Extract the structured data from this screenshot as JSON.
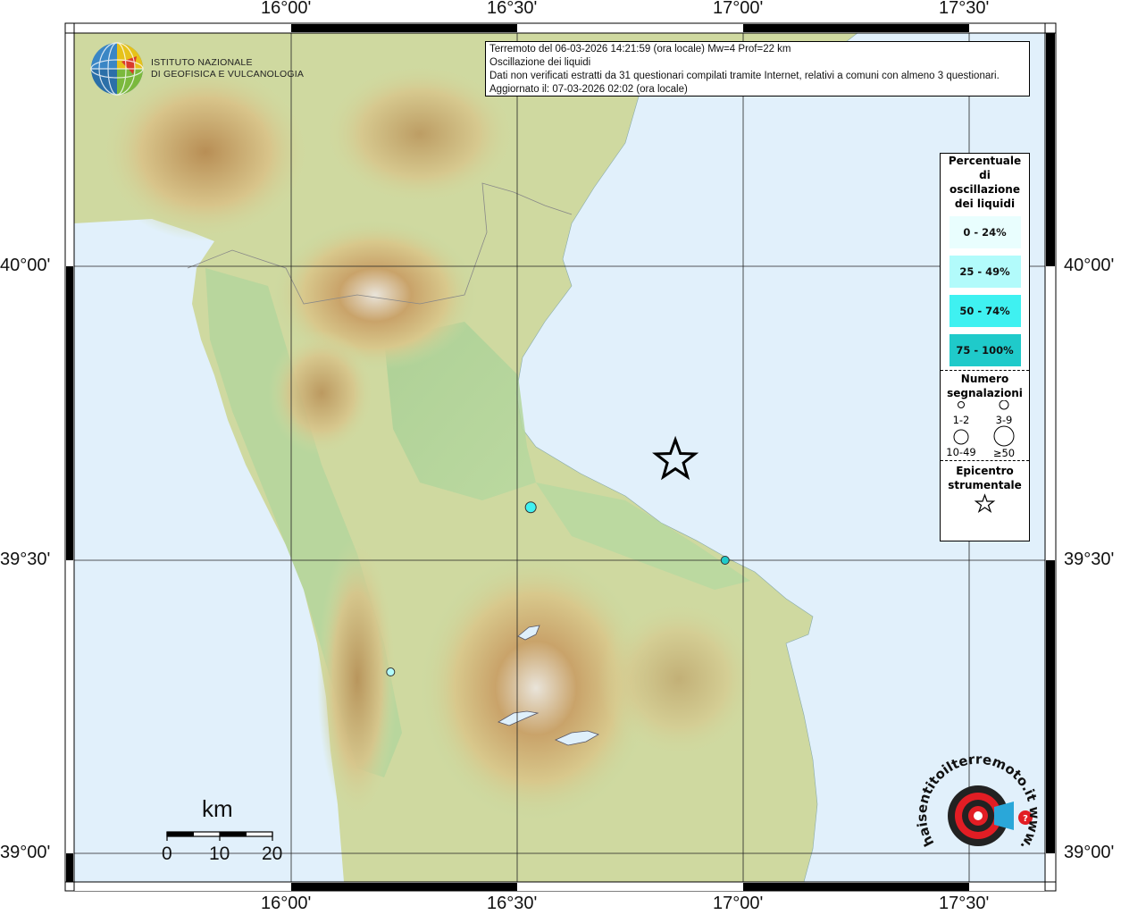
{
  "info": {
    "line1": "Terremoto del 06-03-2026 14:21:59 (ora locale) Mw=4 Prof=22 km",
    "line2": "Oscillazione dei liquidi",
    "line3": "Dati non verificati estratti da 31 questionari compilati tramite Internet, relativi a comuni con almeno 3 questionari.",
    "line4": "Aggiornato il: 07-03-2026 02:02 (ora locale)"
  },
  "logo": {
    "line1": "ISTITUTO NAZIONALE",
    "line2": "DI GEOFISICA E VULCANOLOGIA"
  },
  "axes": {
    "lon_labels": [
      "16°00'",
      "16°30'",
      "17°00'",
      "17°30'"
    ],
    "lat_labels": [
      "40°00'",
      "39°30'",
      "39°00'"
    ]
  },
  "legend": {
    "title": "Percentuale di oscillazione dei liquidi",
    "classes": [
      {
        "label": "0 - 24%",
        "color": "#e9fefe"
      },
      {
        "label": "25 - 49%",
        "color": "#b2fbfb"
      },
      {
        "label": "50 - 74%",
        "color": "#3ff1f1"
      },
      {
        "label": "75 - 100%",
        "color": "#1fcaca"
      }
    ],
    "count_title": "Numero segnalazioni",
    "count_labels": [
      "1-2",
      "3-9",
      "10-49",
      "≥50"
    ],
    "epicenter_title": "Epicentro strumentale"
  },
  "scale": {
    "title": "km",
    "labels": [
      "0",
      "10",
      "20"
    ]
  },
  "points": [
    {
      "lon": 16.53,
      "lat": 39.59,
      "color": "#3ff1f1",
      "count": "3-9"
    },
    {
      "lon": 16.96,
      "lat": 39.5,
      "color": "#1fcaca",
      "count": "1-2"
    },
    {
      "lon": 16.22,
      "lat": 39.31,
      "color": "#b2fbfb",
      "count": "1-2"
    }
  ],
  "epicenter": {
    "lon": 16.85,
    "lat": 39.67
  },
  "watermark": "haisentitoilterremoto.it www."
}
